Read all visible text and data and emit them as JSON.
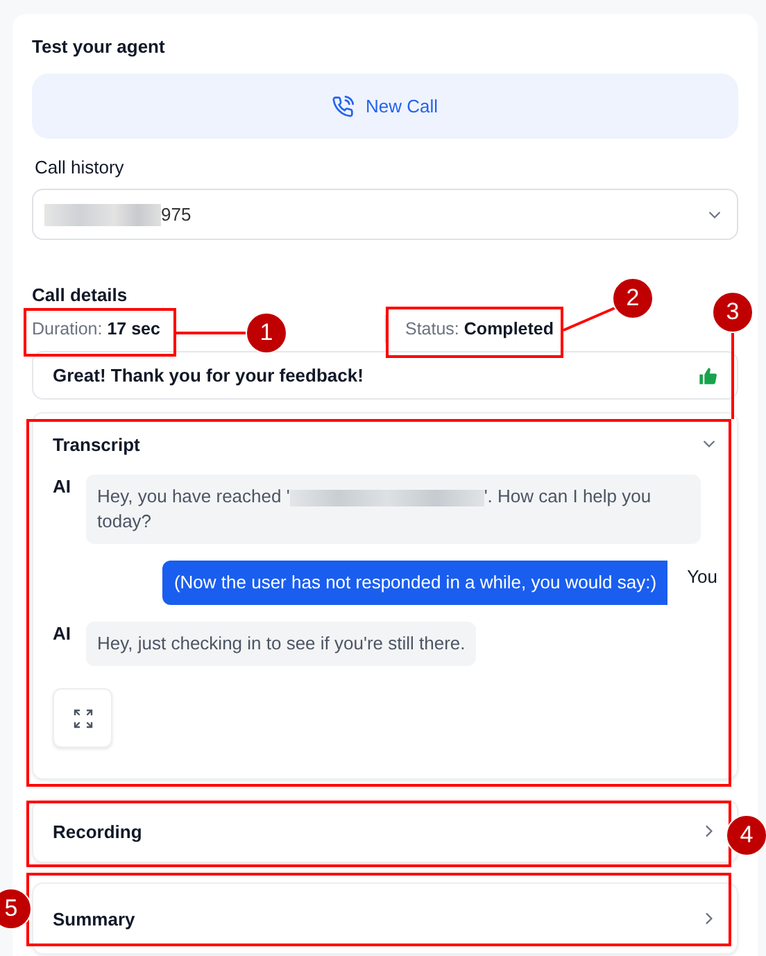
{
  "title": "Test your agent",
  "new_call_button": "New Call",
  "call_history": {
    "label": "Call history",
    "value": "975",
    "redacted_prefix": true
  },
  "call_details": {
    "title": "Call details",
    "duration_label": "Duration:",
    "duration": "17 sec",
    "status_label": "Status:",
    "status": "Completed"
  },
  "feedback": {
    "text": "Great! Thank you for your feedback!",
    "thumbs_up": true
  },
  "transcript": {
    "title": "Transcript",
    "expanded": true,
    "messages": [
      {
        "speaker": "AI",
        "kind": "agent",
        "before": "Hey, you have reached '",
        "redacted": true,
        "after": "'. How can I help you today?"
      },
      {
        "speaker": "You",
        "kind": "user",
        "before": "(Now the user has not responded in a while, you would say:)",
        "redacted": false
      },
      {
        "speaker": "AI",
        "kind": "agent",
        "before": "Hey, just checking in to see if you're still there.",
        "redacted": false
      }
    ]
  },
  "sections": [
    {
      "title": "Recording",
      "expanded": false
    },
    {
      "title": "Summary",
      "expanded": false
    }
  ],
  "annotations": [
    {
      "number": "1"
    },
    {
      "number": "2"
    },
    {
      "number": "3"
    },
    {
      "number": "4"
    },
    {
      "number": "5"
    }
  ]
}
